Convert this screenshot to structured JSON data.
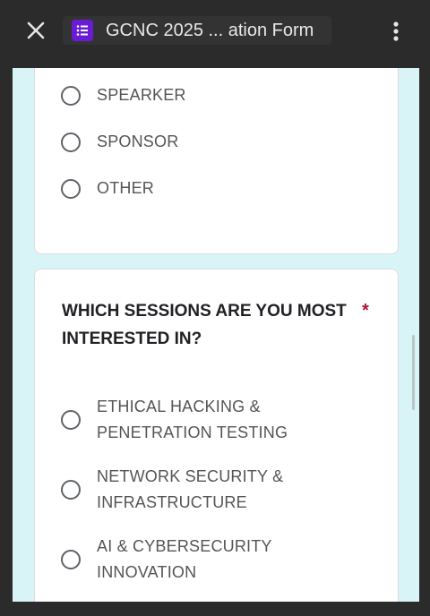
{
  "header": {
    "title": "GCNC 2025 ... ation Form",
    "close_icon": "close-icon",
    "app_icon": "forms-list-icon",
    "menu_icon": "more-vert-icon",
    "app_icon_color": "#6a1bd6"
  },
  "form": {
    "background_color": "#d9f4f6",
    "role_options": [
      {
        "label": "SPEARKER"
      },
      {
        "label": "SPONSOR"
      },
      {
        "label": "OTHER"
      }
    ],
    "sessions_question": {
      "text": "WHICH SESSIONS ARE YOU MOST INTERESTED IN?",
      "required_mark": "*",
      "options": [
        {
          "line1": "ETHICAL HACKING &",
          "line2": "PENETRATION TESTING"
        },
        {
          "line1": "NETWORK SECURITY &",
          "line2": "INFRASTRUCTURE"
        },
        {
          "line1": "AI & CYBERSECURITY",
          "line2": "INNOVATION"
        }
      ]
    }
  }
}
